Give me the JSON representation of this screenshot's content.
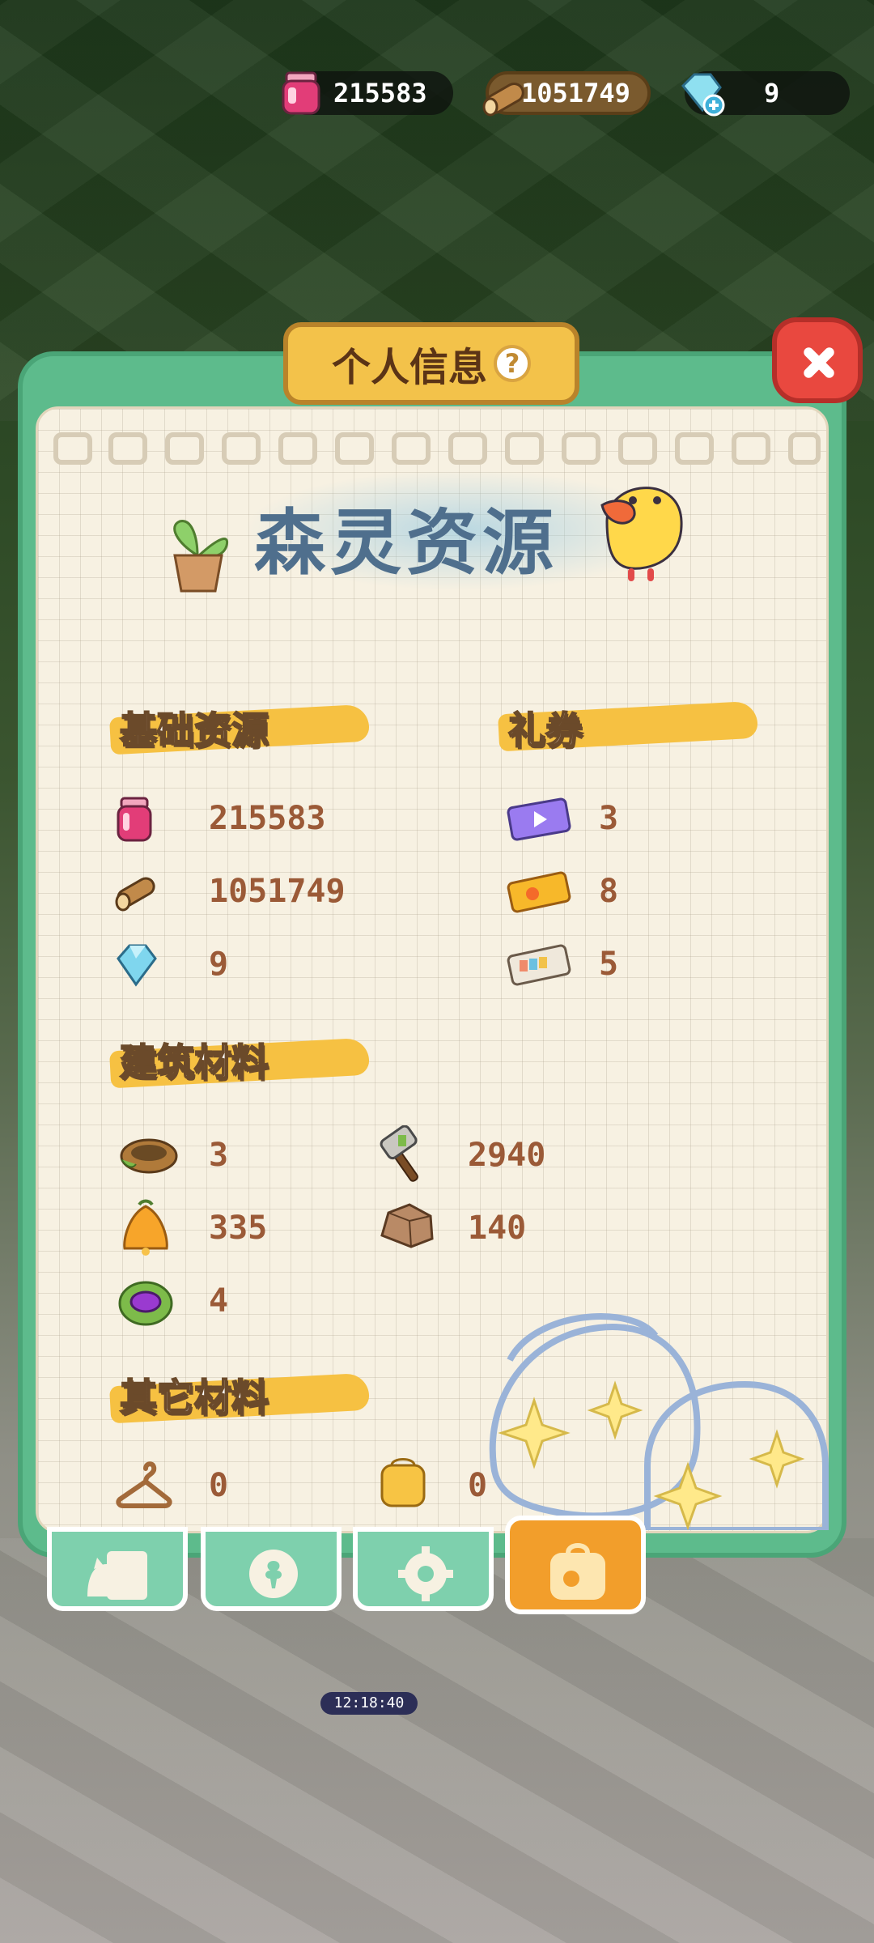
{
  "topbar": {
    "jam": "215583",
    "wood": "1051749",
    "gem": "9"
  },
  "modal": {
    "title": "个人信息",
    "help_symbol": "?",
    "banner_title": "森灵资源"
  },
  "sections": {
    "basic": {
      "title": "基础资源",
      "items": [
        {
          "icon": "jam-jar-icon",
          "value": "215583"
        },
        {
          "icon": "wood-log-icon",
          "value": "1051749"
        },
        {
          "icon": "gem-icon",
          "value": "9"
        }
      ]
    },
    "vouchers": {
      "title": "礼券",
      "items": [
        {
          "icon": "video-ticket-icon",
          "value": "3"
        },
        {
          "icon": "gold-ticket-icon",
          "value": "8"
        },
        {
          "icon": "paper-ticket-icon",
          "value": "5"
        }
      ]
    },
    "building": {
      "title": "建筑材料",
      "items": [
        {
          "icon": "nest-icon",
          "value": "3"
        },
        {
          "icon": "hammer-icon",
          "value": "2940"
        },
        {
          "icon": "orange-bell-icon",
          "value": "335"
        },
        {
          "icon": "stone-icon",
          "value": "140"
        },
        {
          "icon": "purple-cabbage-icon",
          "value": "4"
        }
      ]
    },
    "other": {
      "title": "其它材料",
      "items": [
        {
          "icon": "hanger-icon",
          "value": "0"
        },
        {
          "icon": "yellow-cloth-icon",
          "value": "0"
        }
      ]
    }
  },
  "bottom_tabs": [
    {
      "icon": "cat-card-icon",
      "active": false
    },
    {
      "icon": "badge-icon",
      "active": false
    },
    {
      "icon": "gear-icon",
      "active": false
    },
    {
      "icon": "resource-bag-icon",
      "active": true
    }
  ],
  "background": {
    "timer": "12:18:40"
  }
}
